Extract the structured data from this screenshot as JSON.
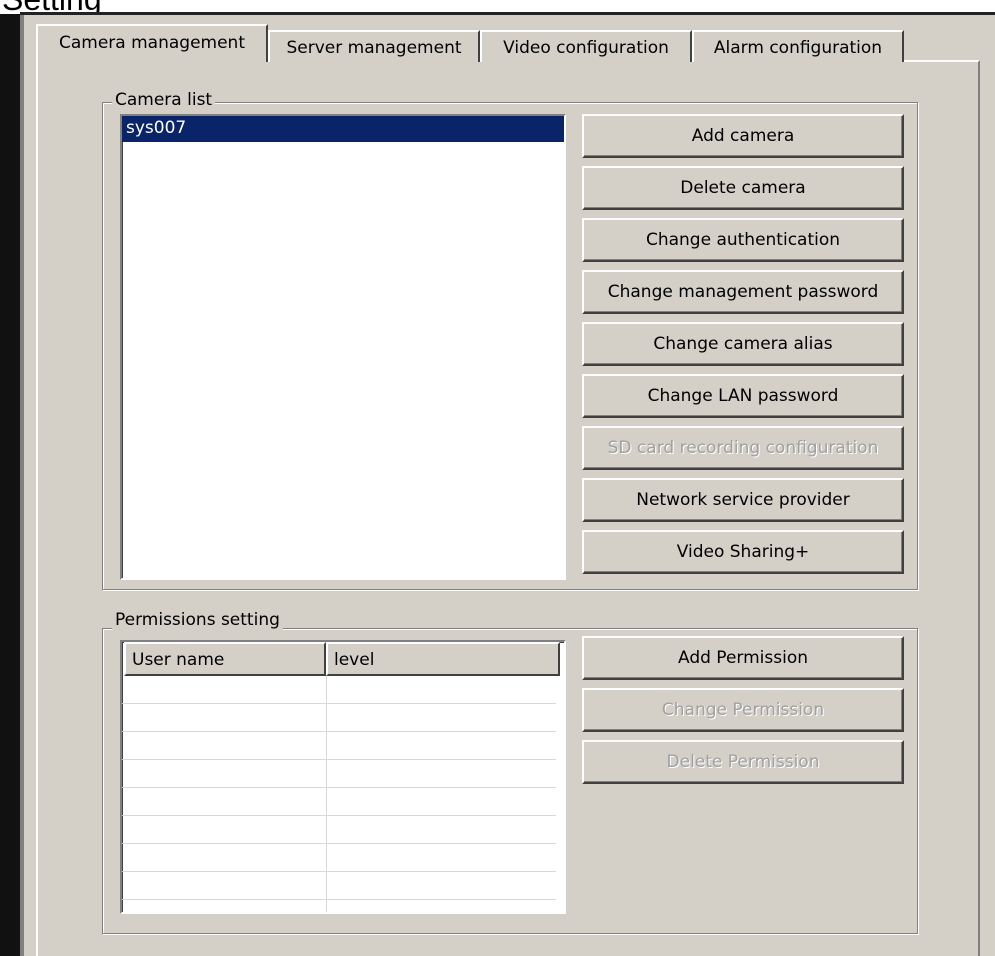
{
  "window": {
    "title": "Setting"
  },
  "tabs": [
    {
      "label": "Camera management",
      "active": true
    },
    {
      "label": "Server management",
      "active": false
    },
    {
      "label": "Video configuration",
      "active": false
    },
    {
      "label": "Alarm configuration",
      "active": false
    }
  ],
  "camera_list": {
    "label": "Camera list",
    "items": [
      {
        "name": "sys007",
        "selected": true
      }
    ],
    "buttons": {
      "add": "Add camera",
      "delete": "Delete camera",
      "change_auth": "Change authentication",
      "change_mgmt_pwd": "Change management password",
      "change_alias": "Change camera alias",
      "change_lan_pwd": "Change LAN password",
      "sd_card": "SD card recording configuration",
      "network_provider": "Network service provider",
      "video_sharing": "Video Sharing+"
    },
    "disabled": [
      "sd_card"
    ]
  },
  "permissions": {
    "label": "Permissions setting",
    "columns": [
      "User name",
      "level"
    ],
    "rows": [],
    "buttons": {
      "add": "Add Permission",
      "change": "Change Permission",
      "delete": "Delete Permission"
    },
    "disabled": [
      "change",
      "delete"
    ]
  },
  "colors": {
    "face": "#d4d0c8",
    "selection": "#0a246a",
    "disabled_text": "#a0a0a0"
  }
}
